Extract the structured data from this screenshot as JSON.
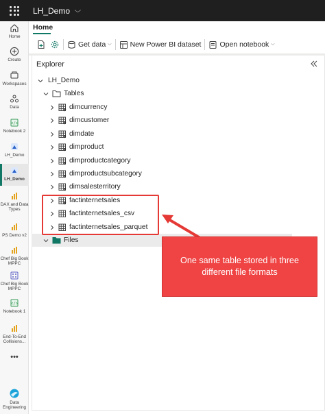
{
  "topbar": {
    "workspace_name": "LH_Demo"
  },
  "leftnav": {
    "items": [
      {
        "label": "Home"
      },
      {
        "label": "Create"
      },
      {
        "label": "Workspaces"
      },
      {
        "label": "Data"
      },
      {
        "label": "Notebook 2"
      },
      {
        "label": "LH_Demo"
      },
      {
        "label": "LH_Demo"
      },
      {
        "label": "DAX and Data Types"
      },
      {
        "label": "PS Demo v2"
      },
      {
        "label": "Chef Big Book MPPC"
      },
      {
        "label": "Chef Big Book MPPC"
      },
      {
        "label": "Notebook 1"
      },
      {
        "label": "End-To-End Collisions..."
      },
      {
        "label": "Data Engineering"
      }
    ],
    "more_label": "•••"
  },
  "ribbon": {
    "tab_home": "Home",
    "get_data": "Get data",
    "new_dataset": "New Power BI dataset",
    "open_notebook": "Open notebook"
  },
  "explorer": {
    "title": "Explorer",
    "root": "LH_Demo",
    "tables_folder": "Tables",
    "tables": [
      "dimcurrency",
      "dimcustomer",
      "dimdate",
      "dimproduct",
      "dimproductcategory",
      "dimproductsubcategory",
      "dimsalesterritory",
      "factinternetsales",
      "factinternetsales_csv",
      "factinternetsales_parquet"
    ],
    "files_folder": "Files"
  },
  "callout": {
    "text": "One same table stored in three different file formats"
  },
  "colors": {
    "accent": "#117865",
    "annotation_red": "#e53935",
    "callout_fill": "#f04444"
  }
}
